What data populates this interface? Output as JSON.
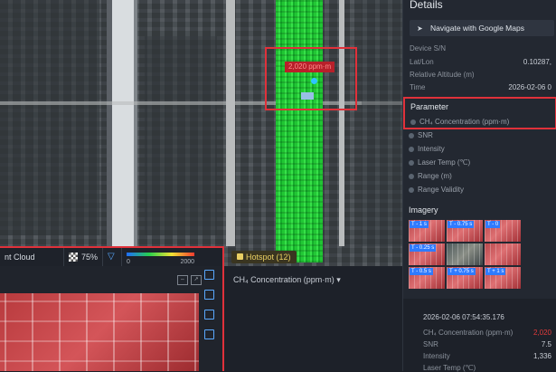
{
  "map": {
    "hotspot_label": "2,020 ppm·m"
  },
  "toolbar": {
    "point_cloud_label": "nt Cloud",
    "opacity_value": "75%",
    "scale_min": "0",
    "scale_max": "2000"
  },
  "hotspot_tab": {
    "label": "Hotspot (12)"
  },
  "chart": {
    "metric_label": "CH₄ Concentration (ppm·m)"
  },
  "details": {
    "title": "Details",
    "navigate_label": "Navigate with Google Maps",
    "fields": [
      {
        "label": "Device S/N",
        "value": ""
      },
      {
        "label": "Lat/Lon",
        "value": "0.10287,"
      },
      {
        "label": "Relative Altitude (m)",
        "value": ""
      },
      {
        "label": "Time",
        "value": "2026-02-06 0"
      }
    ],
    "parameter_title": "Parameter",
    "parameters": [
      "CH₄ Concentration (ppm·m)",
      "SNR",
      "Intensity",
      "Laser Temp (℃)",
      "Range (m)",
      "Range Validity"
    ],
    "imagery_title": "Imagery",
    "imagery_tags": [
      "T - 1 s",
      "T - 0.75 s",
      "T - 0",
      "T - 0.25 s",
      "T - 0.5 s",
      "T + 0.75 s",
      "T + 1 s"
    ],
    "lower": {
      "timestamp": "2026-02-06 07:54:35.176",
      "rows": [
        {
          "label": "CH₄ Concentration (ppm·m)",
          "value": "2,020"
        },
        {
          "label": "SNR",
          "value": "7.5"
        },
        {
          "label": "Intensity",
          "value": "1,336"
        },
        {
          "label": "Laser Temp (℃)",
          "value": ""
        }
      ]
    }
  },
  "colors": {
    "highlight": "#e0313a",
    "accent": "#2f7bff",
    "plume": "#37f04a"
  }
}
